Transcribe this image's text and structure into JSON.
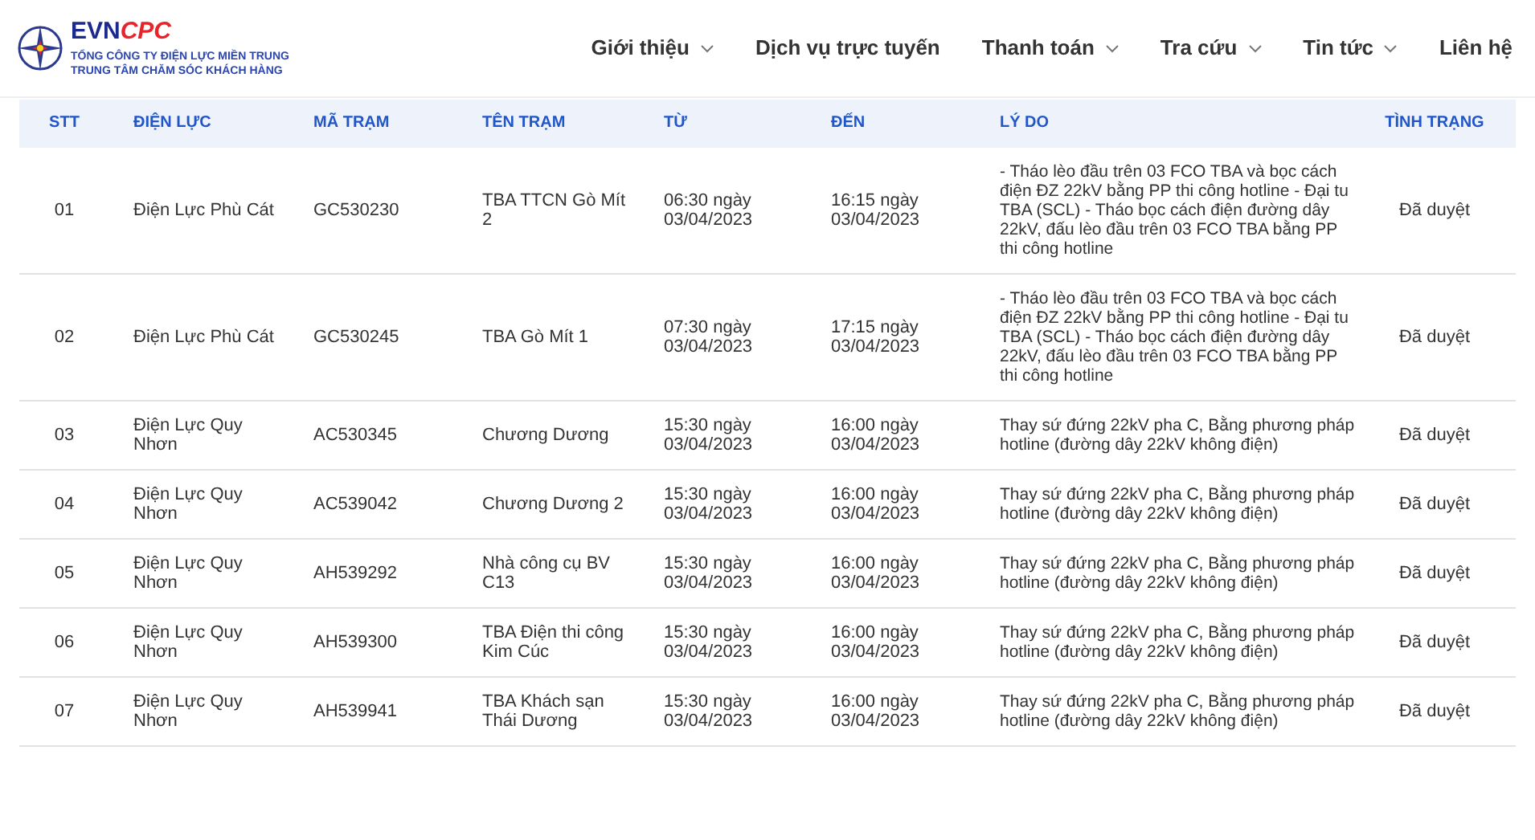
{
  "header": {
    "logo": {
      "brand_main": "EVN",
      "brand_accent": "CPC",
      "line_1": "TỔNG CÔNG TY ĐIỆN LỰC MIỀN TRUNG",
      "line_2": "TRUNG TÂM CHĂM SÓC KHÁCH HÀNG"
    },
    "nav": [
      {
        "label": "Giới thiệu",
        "has_dropdown": true
      },
      {
        "label": "Dịch vụ trực tuyến",
        "has_dropdown": false
      },
      {
        "label": "Thanh toán",
        "has_dropdown": true
      },
      {
        "label": "Tra cứu",
        "has_dropdown": true
      },
      {
        "label": "Tin tức",
        "has_dropdown": true
      },
      {
        "label": "Liên hệ",
        "has_dropdown": false
      }
    ]
  },
  "table": {
    "columns": [
      "STT",
      "ĐIỆN LỰC",
      "MÃ TRẠM",
      "TÊN TRẠM",
      "TỪ",
      "ĐẾN",
      "LÝ DO",
      "TÌNH TRẠNG"
    ],
    "rows": [
      [
        "01",
        "Điện Lực Phù Cát",
        "GC530230",
        "TBA TTCN Gò Mít 2",
        "06:30 ngày 03/04/2023",
        "16:15 ngày 03/04/2023",
        "- Tháo lèo đầu trên 03 FCO TBA và bọc cách điện ĐZ 22kV bằng PP thi công hotline - Đại tu TBA (SCL) - Tháo bọc cách điện đường dây 22kV, đấu lèo đầu trên 03 FCO TBA bằng PP thi công hotline",
        "Đã duyệt"
      ],
      [
        "02",
        "Điện Lực Phù Cát",
        "GC530245",
        "TBA Gò Mít 1",
        "07:30 ngày 03/04/2023",
        "17:15 ngày 03/04/2023",
        "- Tháo lèo đầu trên 03 FCO TBA và bọc cách điện ĐZ 22kV bằng PP thi công hotline - Đại tu TBA (SCL) - Tháo bọc cách điện đường dây 22kV, đấu lèo đầu trên 03 FCO TBA bằng PP thi công hotline",
        "Đã duyệt"
      ],
      [
        "03",
        "Điện Lực Quy Nhơn",
        "AC530345",
        "Chương Dương",
        "15:30 ngày 03/04/2023",
        "16:00 ngày 03/04/2023",
        "Thay sứ đứng 22kV pha C, Bằng phương pháp hotline (đường dây 22kV không điện)",
        "Đã duyệt"
      ],
      [
        "04",
        "Điện Lực Quy Nhơn",
        "AC539042",
        "Chương Dương 2",
        "15:30 ngày 03/04/2023",
        "16:00 ngày 03/04/2023",
        "Thay sứ đứng 22kV pha C, Bằng phương pháp hotline (đường dây 22kV không điện)",
        "Đã duyệt"
      ],
      [
        "05",
        "Điện Lực Quy Nhơn",
        "AH539292",
        "Nhà công cụ BV C13",
        "15:30 ngày 03/04/2023",
        "16:00 ngày 03/04/2023",
        "Thay sứ đứng 22kV pha C, Bằng phương pháp hotline (đường dây 22kV không điện)",
        "Đã duyệt"
      ],
      [
        "06",
        "Điện Lực Quy Nhơn",
        "AH539300",
        "TBA Điện thi công Kim Cúc",
        "15:30 ngày 03/04/2023",
        "16:00 ngày 03/04/2023",
        "Thay sứ đứng 22kV pha C, Bằng phương pháp hotline (đường dây 22kV không điện)",
        "Đã duyệt"
      ],
      [
        "07",
        "Điện Lực Quy Nhơn",
        "AH539941",
        "TBA Khách sạn Thái Dương",
        "15:30 ngày 03/04/2023",
        "16:00 ngày 03/04/2023",
        "Thay sứ đứng 22kV pha C, Bằng phương pháp hotline (đường dây 22kV không điện)",
        "Đã duyệt"
      ]
    ]
  }
}
